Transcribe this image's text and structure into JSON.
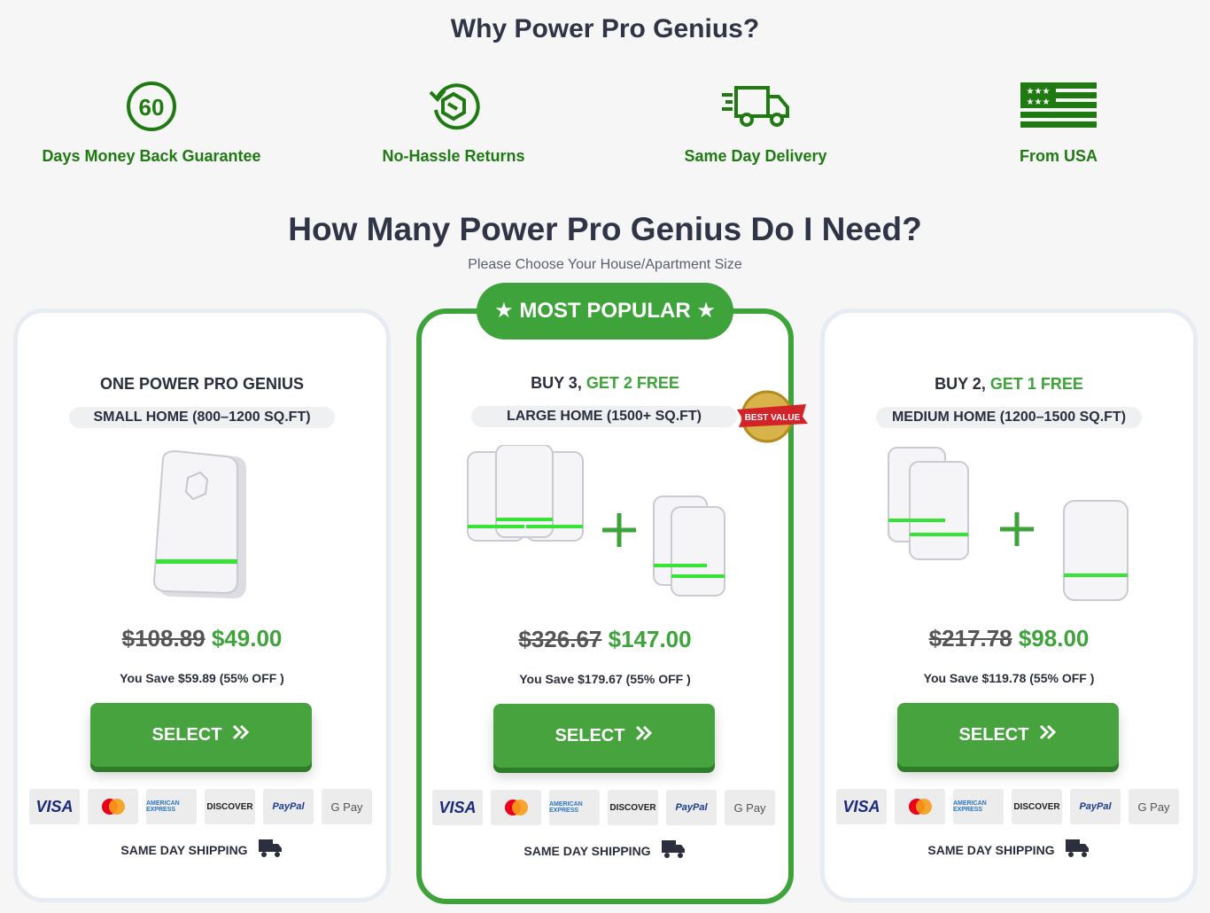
{
  "why": {
    "title": "Why Power Pro Genius?",
    "features": [
      {
        "icon": "sixty-days-icon",
        "icon_text": "60",
        "label": "Days Money Back Guarantee"
      },
      {
        "icon": "returns-icon",
        "label": "No-Hassle Returns"
      },
      {
        "icon": "delivery-truck-icon",
        "label": "Same Day Delivery"
      },
      {
        "icon": "usa-flag-icon",
        "label": "From USA"
      }
    ]
  },
  "how": {
    "title": "How Many Power Pro Genius Do I Need?",
    "subtitle": "Please Choose Your House/Apartment Size"
  },
  "badge": {
    "label": "★  MOST POPULAR  ★"
  },
  "colors": {
    "green": "#3ea33a",
    "dark_text": "#2f3446",
    "feature_green": "#1f7a12"
  },
  "cards": [
    {
      "title_prefix": "ONE POWER PRO GENIUS",
      "title_free": "",
      "size": "SMALL HOME (800–1200 SQ.FT)",
      "old_price": "$108.89",
      "new_price": "$49.00",
      "save": "You Save $59.89 (55% OFF )",
      "select_label": "SELECT",
      "shipping": "SAME DAY SHIPPING"
    },
    {
      "title_prefix": "BUY 3, ",
      "title_free": "GET 2 FREE",
      "size": "LARGE HOME (1500+ SQ.FT)",
      "best_value": "BEST VALUE",
      "old_price": "$326.67",
      "new_price": "$147.00",
      "save": "You Save $179.67 (55% OFF )",
      "select_label": "SELECT",
      "shipping": "SAME DAY SHIPPING"
    },
    {
      "title_prefix": "BUY 2, ",
      "title_free": "GET 1 FREE",
      "size": "MEDIUM HOME (1200–1500 SQ.FT)",
      "old_price": "$217.78",
      "new_price": "$98.00",
      "save": "You Save $119.78 (55% OFF )",
      "select_label": "SELECT",
      "shipping": "SAME DAY SHIPPING"
    }
  ],
  "payments": [
    "VISA",
    "Mastercard",
    "AMERICAN EXPRESS",
    "DISCOVER",
    "PayPal",
    "G Pay"
  ]
}
